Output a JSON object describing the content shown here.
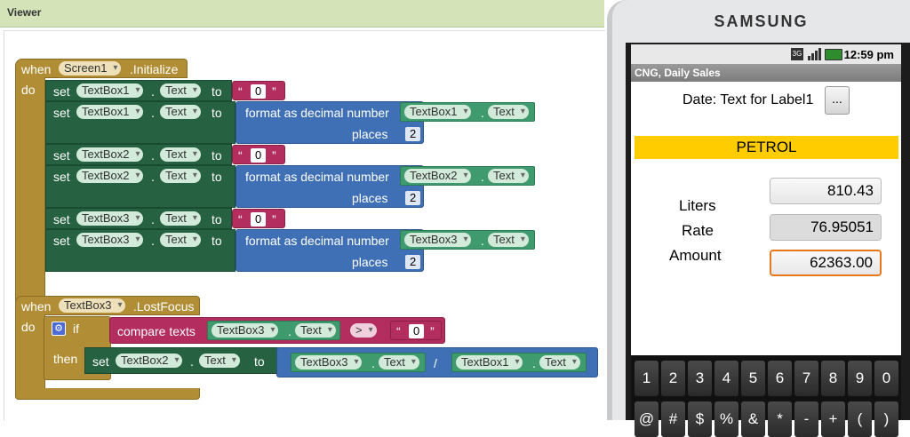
{
  "viewer": {
    "title": "Viewer"
  },
  "colors": {
    "event": "#b18e35",
    "setter": "#266141",
    "math": "#3f70b5",
    "text": "#b32d5e",
    "getter": "#3f9b6d",
    "petrol_bg": "#ffcc00",
    "focus": "#e8781c"
  },
  "block1": {
    "when": "when",
    "component": "Screen1",
    "event": ".Initialize",
    "do": "do",
    "set": "set",
    "to": "to",
    "dot": ".",
    "prop": "Text",
    "rows": [
      {
        "comp": "TextBox1",
        "literal": "0"
      },
      {
        "comp": "TextBox1",
        "fmt": "format as decimal number",
        "get_comp": "TextBox1",
        "places": "places",
        "num": "2"
      },
      {
        "comp": "TextBox2",
        "literal": "0"
      },
      {
        "comp": "TextBox2",
        "fmt": "format as decimal number",
        "get_comp": "TextBox2",
        "places": "places",
        "num": "2"
      },
      {
        "comp": "TextBox3",
        "literal": "0"
      },
      {
        "comp": "TextBox3",
        "fmt": "format as decimal number",
        "get_comp": "TextBox3",
        "places": "places",
        "num": "2"
      }
    ],
    "quote_open": "“",
    "quote_close": "”"
  },
  "block2": {
    "when": "when",
    "component": "TextBox3",
    "event": ".LostFocus",
    "do": "do",
    "if": "if",
    "then": "then",
    "compare": "compare texts",
    "cmp_comp": "TextBox3",
    "cmp_prop": "Text",
    "op": ">",
    "literal": "0",
    "set": "set",
    "set_comp": "TextBox2",
    "set_prop": "Text",
    "to": "to",
    "num_comp": "TextBox3",
    "num_prop": "Text",
    "div": "/",
    "den_comp": "TextBox1",
    "den_prop": "Text"
  },
  "phone": {
    "brand": "SAMSUNG",
    "time": "12:59 pm",
    "app_title": "CNG, Daily Sales",
    "date_label": "Date: Text for Label1",
    "date_button": "...",
    "banner": "PETROL",
    "liters_label": "Liters",
    "rate_label": "Rate",
    "amount_label": "Amount",
    "liters_value": "810.43",
    "rate_value": "76.95051",
    "amount_value": "62363.00",
    "keys": [
      "1",
      "2",
      "3",
      "4",
      "5",
      "6",
      "7",
      "8",
      "9",
      "0"
    ],
    "keys2": [
      "@",
      "#",
      "$",
      "%",
      "&",
      "*",
      "-",
      "+",
      "(",
      ")"
    ]
  }
}
